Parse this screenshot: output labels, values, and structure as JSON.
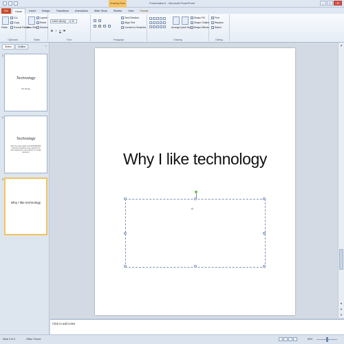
{
  "window": {
    "title": "Presentation1 - Microsoft PowerPoint",
    "context_tab": "Drawing Tools",
    "controls": {
      "minimize": "–",
      "maximize": "□",
      "close": "✕"
    }
  },
  "tabs": [
    "File",
    "Home",
    "Insert",
    "Design",
    "Transitions",
    "Animations",
    "Slide Show",
    "Review",
    "View",
    "Format"
  ],
  "ribbon": {
    "clipboard": {
      "label": "Clipboard",
      "paste": "Paste",
      "cut": "Cut",
      "copy": "Copy",
      "format_painter": "Format Painter"
    },
    "slides": {
      "label": "Slides",
      "new_slide": "New Slide",
      "layout": "Layout",
      "reset": "Reset",
      "section": "Section"
    },
    "font": {
      "label": "Font",
      "family": "Calibri (Body)",
      "size": "32",
      "bold": "B",
      "italic": "I",
      "underline": "U",
      "strike": "S"
    },
    "paragraph": {
      "label": "Paragraph",
      "text_direction": "Text Direction",
      "align_text": "Align Text",
      "smartart": "Convert to SmartArt"
    },
    "drawing": {
      "label": "Drawing",
      "arrange": "Arrange",
      "quick_styles": "Quick Styles",
      "shape_fill": "Shape Fill",
      "shape_outline": "Shape Outline",
      "shape_effects": "Shape Effects"
    },
    "editing": {
      "label": "Editing",
      "find": "Find",
      "replace": "Replace",
      "select": "Select"
    }
  },
  "left_pane": {
    "tabs": [
      "Slides",
      "Outline"
    ],
    "close": "×",
    "slides": [
      {
        "num": "1",
        "title": "Technology",
        "subtitle": "Ms. Bragg"
      },
      {
        "num": "2",
        "title": "Technology",
        "body": "RDS uses apps added tools RFID/RDS/BD Seamless integration sense data Rt Pt of tool integrating are real activities IT of today advanced"
      },
      {
        "num": "3",
        "title": "Why I like technology"
      }
    ]
  },
  "slide": {
    "title": "Why I like technology"
  },
  "notes": {
    "placeholder": "Click to add notes"
  },
  "status": {
    "slide_info": "Slide 3 of 3",
    "theme": "Office Theme",
    "zoom": "64%"
  }
}
